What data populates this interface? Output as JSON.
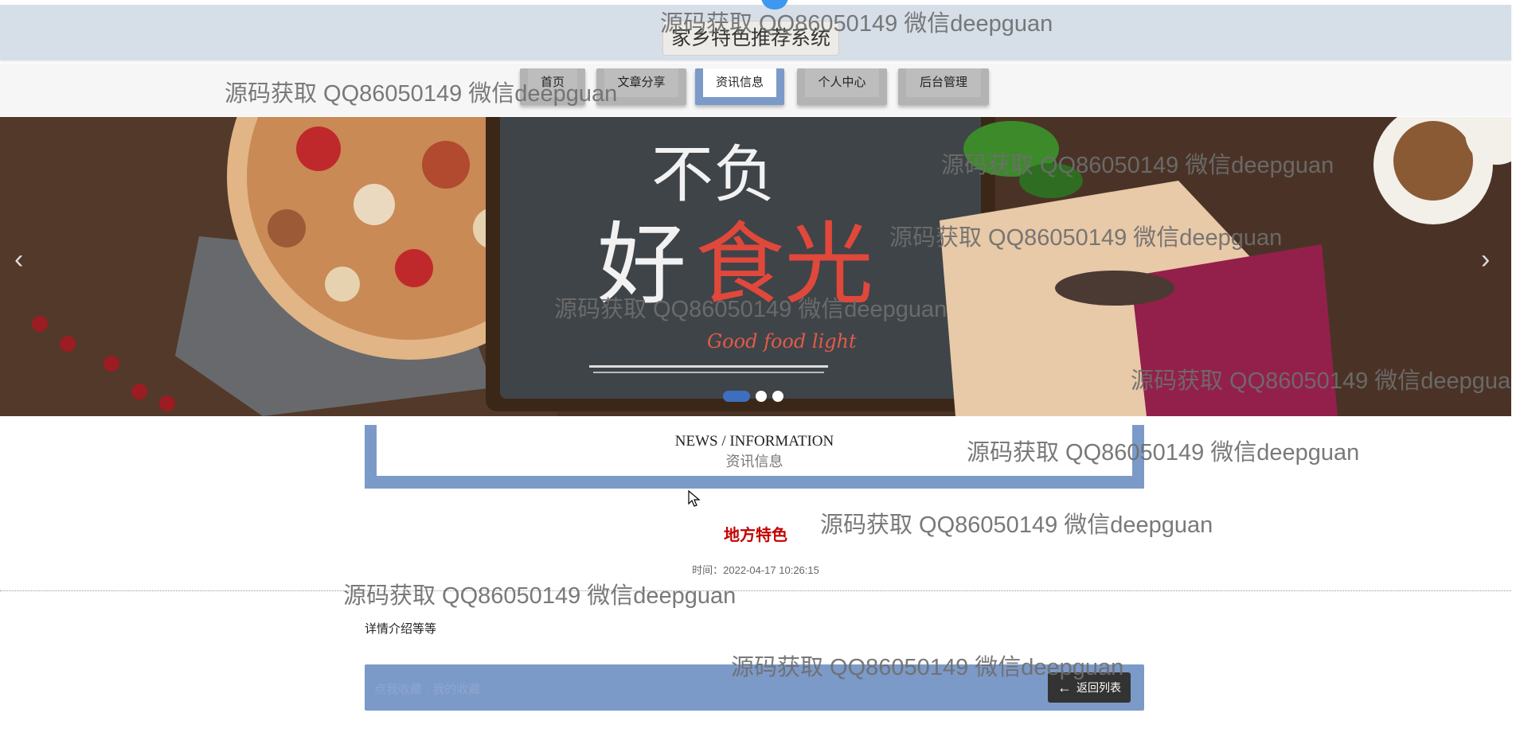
{
  "header": {
    "title": "家乡特色推荐系统"
  },
  "nav": {
    "items": [
      {
        "label": "首页"
      },
      {
        "label": "文章分享"
      },
      {
        "label": "资讯信息",
        "active": true
      },
      {
        "label": "个人中心"
      },
      {
        "label": "后台管理"
      }
    ]
  },
  "banner": {
    "headline_1": "不负",
    "headline_2": "好",
    "headline_3": "食光",
    "tagline": "Good food light",
    "prev_icon": "chevron-left-icon",
    "next_icon": "chevron-right-icon",
    "slide_count": 3,
    "active_slide": 1
  },
  "section": {
    "title_en": "NEWS / INFORMATION",
    "title_cn": "资讯信息"
  },
  "article": {
    "title": "地方特色",
    "time": "时间：2022-04-17 10:26:15",
    "body": "详情介绍等等"
  },
  "footer": {
    "hint": "点我收藏 · 我的收藏",
    "back_label": "返回列表",
    "back_icon": "arrow-left-icon"
  },
  "watermark": {
    "text": "源码获取 QQ86050149 微信deepguan"
  },
  "colors": {
    "accent": "#7c9ac8",
    "title_red": "#c40000",
    "header_bg": "#d6dfe8"
  }
}
